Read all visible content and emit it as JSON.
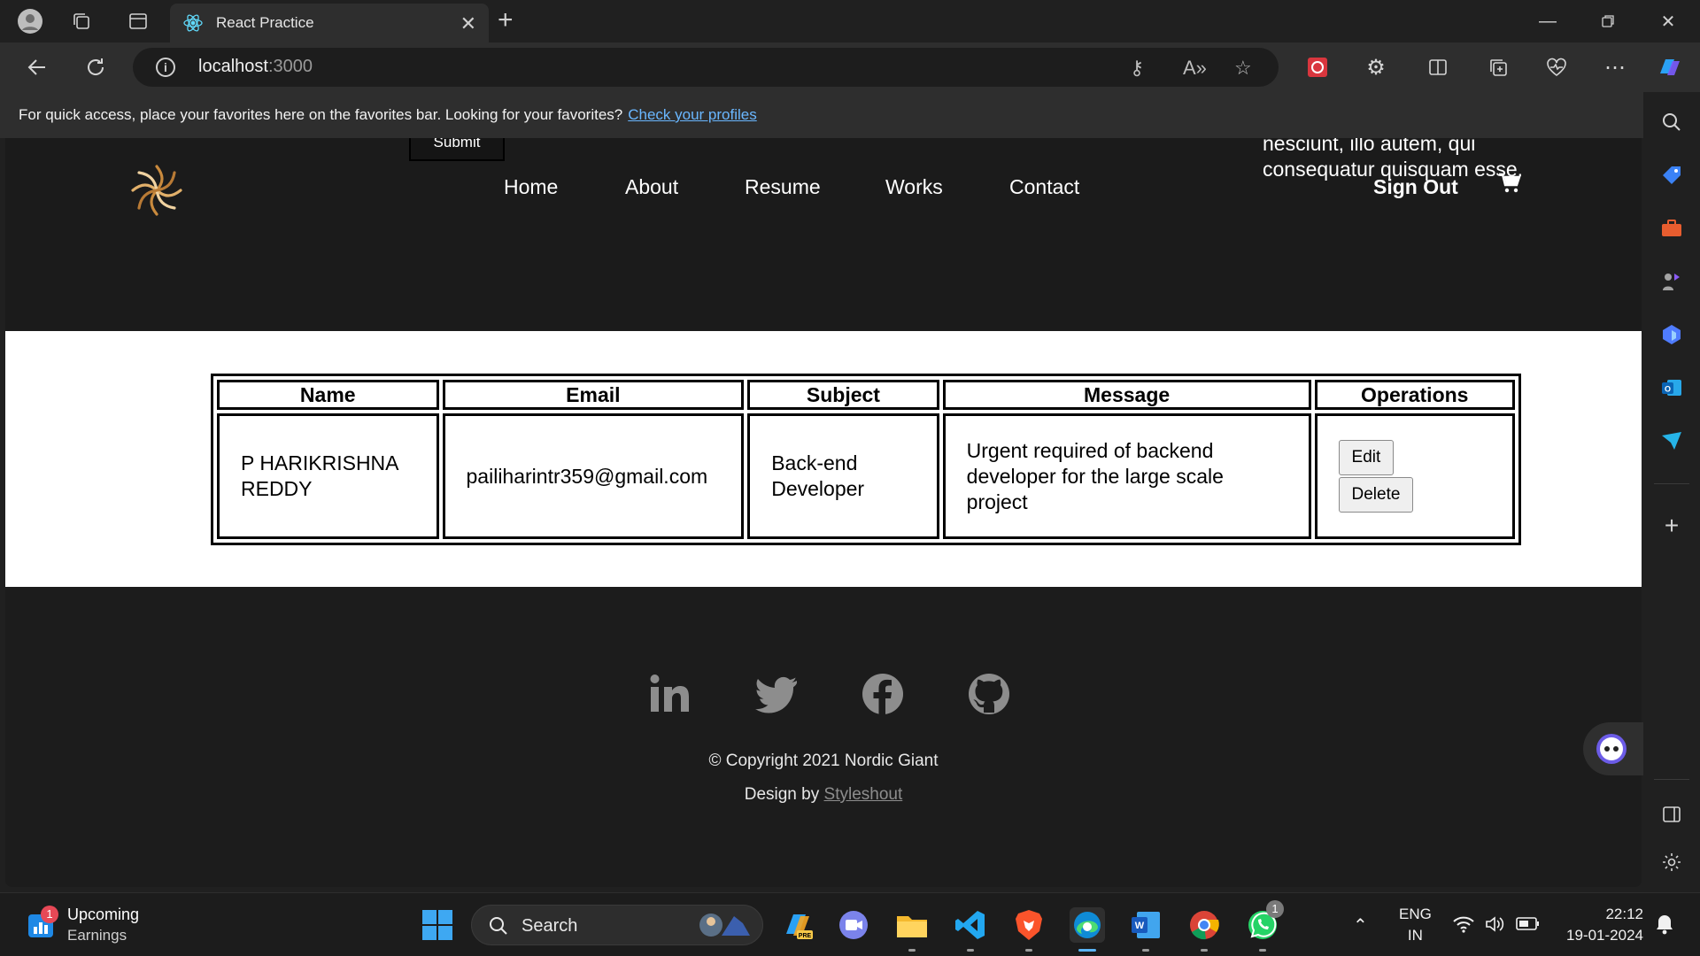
{
  "browser": {
    "tab_title": "React Practice",
    "url_host": "localhost",
    "url_port": ":3000",
    "favorites_text": "For quick access, place your favorites here on the favorites bar. Looking for your favorites?",
    "favorites_link": "Check your profiles"
  },
  "header": {
    "submit_label": "Submit",
    "overflow_text_line1": "nesciunt, illo autem, qui",
    "overflow_text_line2": "consequatur quisquam esse.",
    "nav": [
      "Home",
      "About",
      "Resume",
      "Works",
      "Contact"
    ],
    "sign_out": "Sign Out"
  },
  "table": {
    "headers": [
      "Name",
      "Email",
      "Subject",
      "Message",
      "Operations"
    ],
    "rows": [
      {
        "name": "P HARIKRISHNA REDDY",
        "email": "pailiharintr359@gmail.com",
        "subject": "Back-end Developer",
        "message": "Urgent required of backend developer for the large scale project",
        "edit": "Edit",
        "delete": "Delete"
      }
    ]
  },
  "footer": {
    "copyright": "© Copyright 2021 Nordic Giant",
    "design_by": "Design by",
    "design_link": "Styleshout",
    "social_icons": [
      "linkedin-icon",
      "twitter-icon",
      "facebook-icon",
      "github-icon"
    ]
  },
  "taskbar": {
    "weather_title": "Upcoming",
    "weather_sub": "Earnings",
    "weather_badge": "1",
    "search_label": "Search",
    "whatsapp_badge": "1",
    "lang_line1": "ENG",
    "lang_line2": "IN",
    "time": "22:12",
    "date": "19-01-2024"
  },
  "colors": {
    "accent_link": "#6ab7ff",
    "page_dark": "#1c1c1c",
    "page_light": "#ffffff"
  }
}
